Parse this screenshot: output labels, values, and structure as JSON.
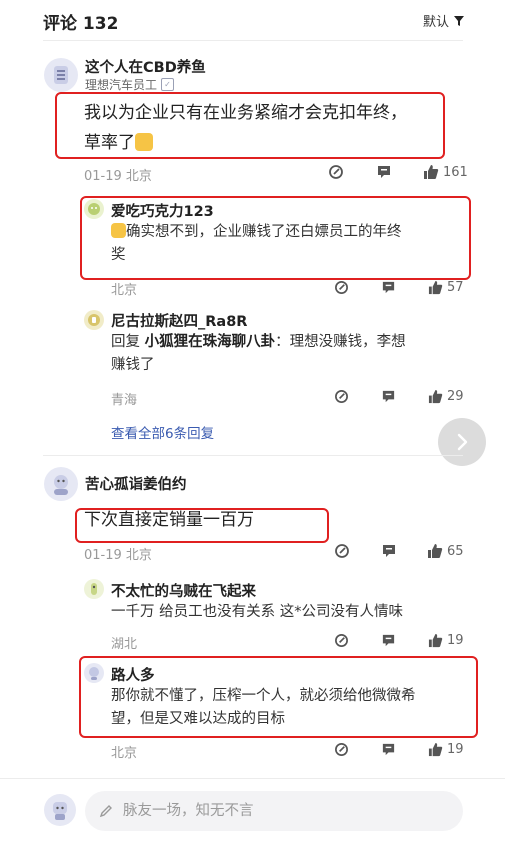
{
  "header": {
    "title": "评论 132",
    "sort_label": "默认"
  },
  "comments": [
    {
      "author": "这个人在CBD养鱼",
      "badge": "理想汽车员工",
      "text_line1": "我以为企业只有在业务紧缩才会克扣年终，",
      "text_line2": "草率了",
      "date": "01-19",
      "location": "北京",
      "likes": "161",
      "replies": [
        {
          "author": "爱吃巧克力123",
          "text_line1": "确实想不到，企业赚钱了还白嫖员工的年终",
          "text_line2": "奖",
          "location": "北京",
          "likes": "57"
        },
        {
          "author": "尼古拉斯赵四_Ra8R",
          "reply_prefix": "回复",
          "reply_to": "小狐狸在珠海聊八卦",
          "reply_colon": "：",
          "text_line1_rest": "理想没赚钱，李想",
          "text_line2": "赚钱了",
          "location": "青海",
          "likes": "29"
        }
      ],
      "view_all": "查看全部6条回复"
    },
    {
      "author": "苦心孤诣姜伯约",
      "text": "下次直接定销量一百万",
      "date": "01-19",
      "location": "北京",
      "likes": "65",
      "replies": [
        {
          "author": "不太忙的乌贼在飞起来",
          "text": "一千万 给员工也没有关系 这*公司没有人情味",
          "location": "湖北",
          "likes": "19"
        },
        {
          "author": "路人多",
          "text_line1": "那你就不懂了，压榨一个人，就必须给他微微希",
          "text_line2": "望，但是又难以达成的目标",
          "location": "北京",
          "likes": "19"
        }
      ]
    }
  ],
  "composer": {
    "placeholder": "脉友一场，知无不言"
  },
  "colors": {
    "highlight": "#e02020",
    "link": "#3a5bb0"
  },
  "icons": [
    "filter-icon",
    "edit-icon",
    "comment-icon",
    "thumb-up-icon",
    "chevron-right-icon"
  ]
}
